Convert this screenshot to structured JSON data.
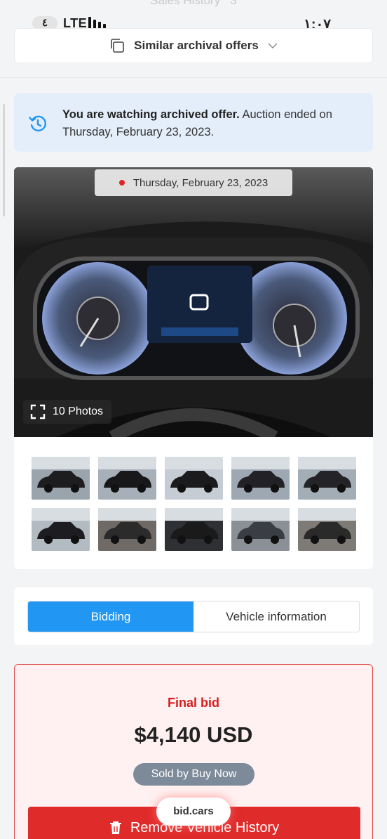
{
  "status_bar": {
    "badge": "٤",
    "network": "LTE",
    "time": "١:٠٧"
  },
  "ghost_row": {
    "label": "Sales History",
    "count": "3"
  },
  "similar_offers": {
    "label": "Similar archival offers",
    "icon": "copy-icon"
  },
  "notice": {
    "title": "You are watching archived offer.",
    "text": "Auction ended on Thursday, February 23, 2023.",
    "icon": "history-icon",
    "background": "#e4eefa"
  },
  "gallery": {
    "date": "Thursday, February 23, 2023",
    "photos_label": "10 Photos",
    "thumbnails": [
      {
        "name": "front-left"
      },
      {
        "name": "rear-left"
      },
      {
        "name": "rear-right"
      },
      {
        "name": "front-right"
      },
      {
        "name": "front"
      },
      {
        "name": "rear"
      },
      {
        "name": "interior-front"
      },
      {
        "name": "dashboard"
      },
      {
        "name": "instrument-cluster"
      },
      {
        "name": "interior-rear"
      }
    ]
  },
  "tabs": [
    {
      "label": "Bidding",
      "active": true
    },
    {
      "label": "Vehicle information",
      "active": false
    }
  ],
  "bid": {
    "label": "Final bid",
    "value": "$4,140 USD",
    "status": "Sold by Buy Now",
    "remove_label": "Remove Vehicle History"
  },
  "watermark": "bid.cars",
  "colors": {
    "accent": "#2196f3",
    "danger": "#e02b2b",
    "bid_label": "#d81b1b",
    "badge": "#7d8a99"
  }
}
